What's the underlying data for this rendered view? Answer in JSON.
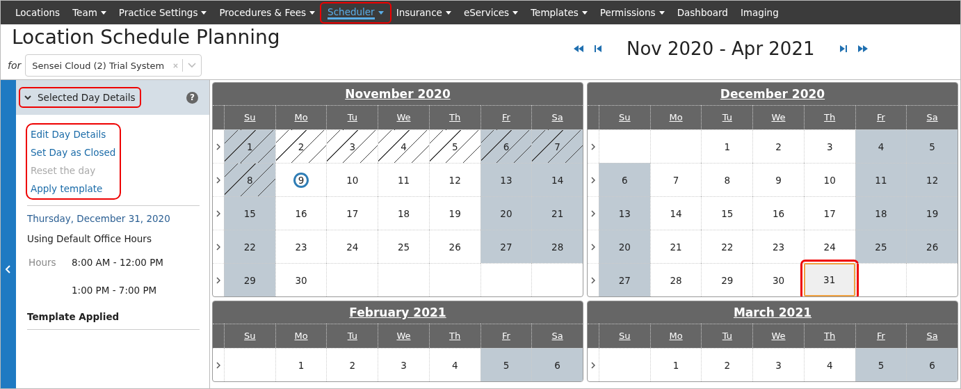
{
  "nav": [
    {
      "label": "Locations",
      "has_menu": false,
      "selected": false,
      "annotated": false
    },
    {
      "label": "Team",
      "has_menu": true,
      "selected": false,
      "annotated": false
    },
    {
      "label": "Practice Settings",
      "has_menu": true,
      "selected": false,
      "annotated": false
    },
    {
      "label": "Procedures & Fees",
      "has_menu": true,
      "selected": false,
      "annotated": false
    },
    {
      "label": "Scheduler",
      "has_menu": true,
      "selected": true,
      "annotated": true
    },
    {
      "label": "Insurance",
      "has_menu": true,
      "selected": false,
      "annotated": false
    },
    {
      "label": "eServices",
      "has_menu": true,
      "selected": false,
      "annotated": false
    },
    {
      "label": "Templates",
      "has_menu": true,
      "selected": false,
      "annotated": false
    },
    {
      "label": "Permissions",
      "has_menu": true,
      "selected": false,
      "annotated": false
    },
    {
      "label": "Dashboard",
      "has_menu": false,
      "selected": false,
      "annotated": false
    },
    {
      "label": "Imaging",
      "has_menu": false,
      "selected": false,
      "annotated": false
    }
  ],
  "page_title": "Location Schedule Planning",
  "for_label": "for",
  "location_select": {
    "value": "Sensei Cloud (2) Trial System"
  },
  "range_title": "Nov 2020 - Apr 2021",
  "panel": {
    "title": "Selected Day Details",
    "expanded": true,
    "annotated": true,
    "help": "?",
    "actions_annotated": true,
    "actions": [
      {
        "label": "Edit Day Details",
        "disabled": false
      },
      {
        "label": "Set Day as Closed",
        "disabled": false
      },
      {
        "label": "Reset the day",
        "disabled": true
      },
      {
        "label": "Apply template",
        "disabled": false
      }
    ],
    "date": "Thursday, December 31, 2020",
    "hours_source": "Using Default Office Hours",
    "hours_label": "Hours",
    "hours": [
      "8:00 AM - 12:00 PM",
      "1:00 PM - 7:00 PM"
    ],
    "template_status": "Template Applied"
  },
  "months": [
    {
      "title": "November 2020",
      "weekdays": [
        "Su",
        "Mo",
        "Tu",
        "We",
        "Th",
        "Fr",
        "Sa"
      ],
      "weeks": [
        [
          {
            "kind": "day",
            "day": "1",
            "shaded": true,
            "hatched": true,
            "today": false,
            "selected": false,
            "annotated": false
          },
          {
            "kind": "day",
            "day": "2",
            "shaded": false,
            "hatched": true,
            "today": false,
            "selected": false,
            "annotated": false
          },
          {
            "kind": "day",
            "day": "3",
            "shaded": false,
            "hatched": true,
            "today": false,
            "selected": false,
            "annotated": false
          },
          {
            "kind": "day",
            "day": "4",
            "shaded": false,
            "hatched": true,
            "today": false,
            "selected": false,
            "annotated": false
          },
          {
            "kind": "day",
            "day": "5",
            "shaded": false,
            "hatched": true,
            "today": false,
            "selected": false,
            "annotated": false
          },
          {
            "kind": "day",
            "day": "6",
            "shaded": true,
            "hatched": true,
            "today": false,
            "selected": false,
            "annotated": false
          },
          {
            "kind": "day",
            "day": "7",
            "shaded": true,
            "hatched": true,
            "today": false,
            "selected": false,
            "annotated": false
          }
        ],
        [
          {
            "kind": "day",
            "day": "8",
            "shaded": true,
            "hatched": true,
            "today": false,
            "selected": false,
            "annotated": false
          },
          {
            "kind": "day",
            "day": "9",
            "shaded": false,
            "hatched": false,
            "today": true,
            "selected": false,
            "annotated": false
          },
          {
            "kind": "day",
            "day": "10",
            "shaded": false,
            "hatched": false,
            "today": false,
            "selected": false,
            "annotated": false
          },
          {
            "kind": "day",
            "day": "11",
            "shaded": false,
            "hatched": false,
            "today": false,
            "selected": false,
            "annotated": false
          },
          {
            "kind": "day",
            "day": "12",
            "shaded": false,
            "hatched": false,
            "today": false,
            "selected": false,
            "annotated": false
          },
          {
            "kind": "day",
            "day": "13",
            "shaded": true,
            "hatched": false,
            "today": false,
            "selected": false,
            "annotated": false
          },
          {
            "kind": "day",
            "day": "14",
            "shaded": true,
            "hatched": false,
            "today": false,
            "selected": false,
            "annotated": false
          }
        ],
        [
          {
            "kind": "day",
            "day": "15",
            "shaded": true,
            "hatched": false,
            "today": false,
            "selected": false,
            "annotated": false
          },
          {
            "kind": "day",
            "day": "16",
            "shaded": false,
            "hatched": false,
            "today": false,
            "selected": false,
            "annotated": false
          },
          {
            "kind": "day",
            "day": "17",
            "shaded": false,
            "hatched": false,
            "today": false,
            "selected": false,
            "annotated": false
          },
          {
            "kind": "day",
            "day": "18",
            "shaded": false,
            "hatched": false,
            "today": false,
            "selected": false,
            "annotated": false
          },
          {
            "kind": "day",
            "day": "19",
            "shaded": false,
            "hatched": false,
            "today": false,
            "selected": false,
            "annotated": false
          },
          {
            "kind": "day",
            "day": "20",
            "shaded": true,
            "hatched": false,
            "today": false,
            "selected": false,
            "annotated": false
          },
          {
            "kind": "day",
            "day": "21",
            "shaded": true,
            "hatched": false,
            "today": false,
            "selected": false,
            "annotated": false
          }
        ],
        [
          {
            "kind": "day",
            "day": "22",
            "shaded": true,
            "hatched": false,
            "today": false,
            "selected": false,
            "annotated": false
          },
          {
            "kind": "day",
            "day": "23",
            "shaded": false,
            "hatched": false,
            "today": false,
            "selected": false,
            "annotated": false
          },
          {
            "kind": "day",
            "day": "24",
            "shaded": false,
            "hatched": false,
            "today": false,
            "selected": false,
            "annotated": false
          },
          {
            "kind": "day",
            "day": "25",
            "shaded": false,
            "hatched": false,
            "today": false,
            "selected": false,
            "annotated": false
          },
          {
            "kind": "day",
            "day": "26",
            "shaded": false,
            "hatched": false,
            "today": false,
            "selected": false,
            "annotated": false
          },
          {
            "kind": "day",
            "day": "27",
            "shaded": true,
            "hatched": false,
            "today": false,
            "selected": false,
            "annotated": false
          },
          {
            "kind": "day",
            "day": "28",
            "shaded": true,
            "hatched": false,
            "today": false,
            "selected": false,
            "annotated": false
          }
        ],
        [
          {
            "kind": "day",
            "day": "29",
            "shaded": true,
            "hatched": false,
            "today": false,
            "selected": false,
            "annotated": false
          },
          {
            "kind": "day",
            "day": "30",
            "shaded": false,
            "hatched": false,
            "today": false,
            "selected": false,
            "annotated": false
          },
          {
            "kind": "blank"
          },
          {
            "kind": "blank"
          },
          {
            "kind": "blank"
          },
          {
            "kind": "blank"
          },
          {
            "kind": "blank"
          }
        ]
      ]
    },
    {
      "title": "December 2020",
      "weekdays": [
        "Su",
        "Mo",
        "Tu",
        "We",
        "Th",
        "Fr",
        "Sa"
      ],
      "weeks": [
        [
          {
            "kind": "blank"
          },
          {
            "kind": "blank"
          },
          {
            "kind": "day",
            "day": "1",
            "shaded": false,
            "hatched": false,
            "today": false,
            "selected": false,
            "annotated": false
          },
          {
            "kind": "day",
            "day": "2",
            "shaded": false,
            "hatched": false,
            "today": false,
            "selected": false,
            "annotated": false
          },
          {
            "kind": "day",
            "day": "3",
            "shaded": false,
            "hatched": false,
            "today": false,
            "selected": false,
            "annotated": false
          },
          {
            "kind": "day",
            "day": "4",
            "shaded": true,
            "hatched": false,
            "today": false,
            "selected": false,
            "annotated": false
          },
          {
            "kind": "day",
            "day": "5",
            "shaded": true,
            "hatched": false,
            "today": false,
            "selected": false,
            "annotated": false
          }
        ],
        [
          {
            "kind": "day",
            "day": "6",
            "shaded": true,
            "hatched": false,
            "today": false,
            "selected": false,
            "annotated": false
          },
          {
            "kind": "day",
            "day": "7",
            "shaded": false,
            "hatched": false,
            "today": false,
            "selected": false,
            "annotated": false
          },
          {
            "kind": "day",
            "day": "8",
            "shaded": false,
            "hatched": false,
            "today": false,
            "selected": false,
            "annotated": false
          },
          {
            "kind": "day",
            "day": "9",
            "shaded": false,
            "hatched": false,
            "today": false,
            "selected": false,
            "annotated": false
          },
          {
            "kind": "day",
            "day": "10",
            "shaded": false,
            "hatched": false,
            "today": false,
            "selected": false,
            "annotated": false
          },
          {
            "kind": "day",
            "day": "11",
            "shaded": true,
            "hatched": false,
            "today": false,
            "selected": false,
            "annotated": false
          },
          {
            "kind": "day",
            "day": "12",
            "shaded": true,
            "hatched": false,
            "today": false,
            "selected": false,
            "annotated": false
          }
        ],
        [
          {
            "kind": "day",
            "day": "13",
            "shaded": true,
            "hatched": false,
            "today": false,
            "selected": false,
            "annotated": false
          },
          {
            "kind": "day",
            "day": "14",
            "shaded": false,
            "hatched": false,
            "today": false,
            "selected": false,
            "annotated": false
          },
          {
            "kind": "day",
            "day": "15",
            "shaded": false,
            "hatched": false,
            "today": false,
            "selected": false,
            "annotated": false
          },
          {
            "kind": "day",
            "day": "16",
            "shaded": false,
            "hatched": false,
            "today": false,
            "selected": false,
            "annotated": false
          },
          {
            "kind": "day",
            "day": "17",
            "shaded": false,
            "hatched": false,
            "today": false,
            "selected": false,
            "annotated": false
          },
          {
            "kind": "day",
            "day": "18",
            "shaded": true,
            "hatched": false,
            "today": false,
            "selected": false,
            "annotated": false
          },
          {
            "kind": "day",
            "day": "19",
            "shaded": true,
            "hatched": false,
            "today": false,
            "selected": false,
            "annotated": false
          }
        ],
        [
          {
            "kind": "day",
            "day": "20",
            "shaded": true,
            "hatched": false,
            "today": false,
            "selected": false,
            "annotated": false
          },
          {
            "kind": "day",
            "day": "21",
            "shaded": false,
            "hatched": false,
            "today": false,
            "selected": false,
            "annotated": false
          },
          {
            "kind": "day",
            "day": "22",
            "shaded": false,
            "hatched": false,
            "today": false,
            "selected": false,
            "annotated": false
          },
          {
            "kind": "day",
            "day": "23",
            "shaded": false,
            "hatched": false,
            "today": false,
            "selected": false,
            "annotated": false
          },
          {
            "kind": "day",
            "day": "24",
            "shaded": false,
            "hatched": false,
            "today": false,
            "selected": false,
            "annotated": false
          },
          {
            "kind": "day",
            "day": "25",
            "shaded": true,
            "hatched": false,
            "today": false,
            "selected": false,
            "annotated": false
          },
          {
            "kind": "day",
            "day": "26",
            "shaded": true,
            "hatched": false,
            "today": false,
            "selected": false,
            "annotated": false
          }
        ],
        [
          {
            "kind": "day",
            "day": "27",
            "shaded": true,
            "hatched": false,
            "today": false,
            "selected": false,
            "annotated": false
          },
          {
            "kind": "day",
            "day": "28",
            "shaded": false,
            "hatched": false,
            "today": false,
            "selected": false,
            "annotated": false
          },
          {
            "kind": "day",
            "day": "29",
            "shaded": false,
            "hatched": false,
            "today": false,
            "selected": false,
            "annotated": false
          },
          {
            "kind": "day",
            "day": "30",
            "shaded": false,
            "hatched": false,
            "today": false,
            "selected": false,
            "annotated": false
          },
          {
            "kind": "day",
            "day": "31",
            "shaded": false,
            "hatched": false,
            "today": false,
            "selected": true,
            "annotated": true
          },
          {
            "kind": "blank"
          },
          {
            "kind": "blank"
          }
        ]
      ]
    },
    {
      "title": "February 2021",
      "weekdays": [
        "Su",
        "Mo",
        "Tu",
        "We",
        "Th",
        "Fr",
        "Sa"
      ],
      "weeks": [
        [
          {
            "kind": "blank"
          },
          {
            "kind": "day",
            "day": "1",
            "shaded": false,
            "hatched": false,
            "today": false,
            "selected": false,
            "annotated": false
          },
          {
            "kind": "day",
            "day": "2",
            "shaded": false,
            "hatched": false,
            "today": false,
            "selected": false,
            "annotated": false
          },
          {
            "kind": "day",
            "day": "3",
            "shaded": false,
            "hatched": false,
            "today": false,
            "selected": false,
            "annotated": false
          },
          {
            "kind": "day",
            "day": "4",
            "shaded": false,
            "hatched": false,
            "today": false,
            "selected": false,
            "annotated": false
          },
          {
            "kind": "day",
            "day": "5",
            "shaded": true,
            "hatched": false,
            "today": false,
            "selected": false,
            "annotated": false
          },
          {
            "kind": "day",
            "day": "6",
            "shaded": true,
            "hatched": false,
            "today": false,
            "selected": false,
            "annotated": false
          }
        ]
      ]
    },
    {
      "title": "March 2021",
      "weekdays": [
        "Su",
        "Mo",
        "Tu",
        "We",
        "Th",
        "Fr",
        "Sa"
      ],
      "weeks": [
        [
          {
            "kind": "blank"
          },
          {
            "kind": "day",
            "day": "1",
            "shaded": false,
            "hatched": false,
            "today": false,
            "selected": false,
            "annotated": false
          },
          {
            "kind": "day",
            "day": "2",
            "shaded": false,
            "hatched": false,
            "today": false,
            "selected": false,
            "annotated": false
          },
          {
            "kind": "day",
            "day": "3",
            "shaded": false,
            "hatched": false,
            "today": false,
            "selected": false,
            "annotated": false
          },
          {
            "kind": "day",
            "day": "4",
            "shaded": false,
            "hatched": false,
            "today": false,
            "selected": false,
            "annotated": false
          },
          {
            "kind": "day",
            "day": "5",
            "shaded": true,
            "hatched": false,
            "today": false,
            "selected": false,
            "annotated": false
          },
          {
            "kind": "day",
            "day": "6",
            "shaded": true,
            "hatched": false,
            "today": false,
            "selected": false,
            "annotated": false
          }
        ]
      ]
    }
  ]
}
